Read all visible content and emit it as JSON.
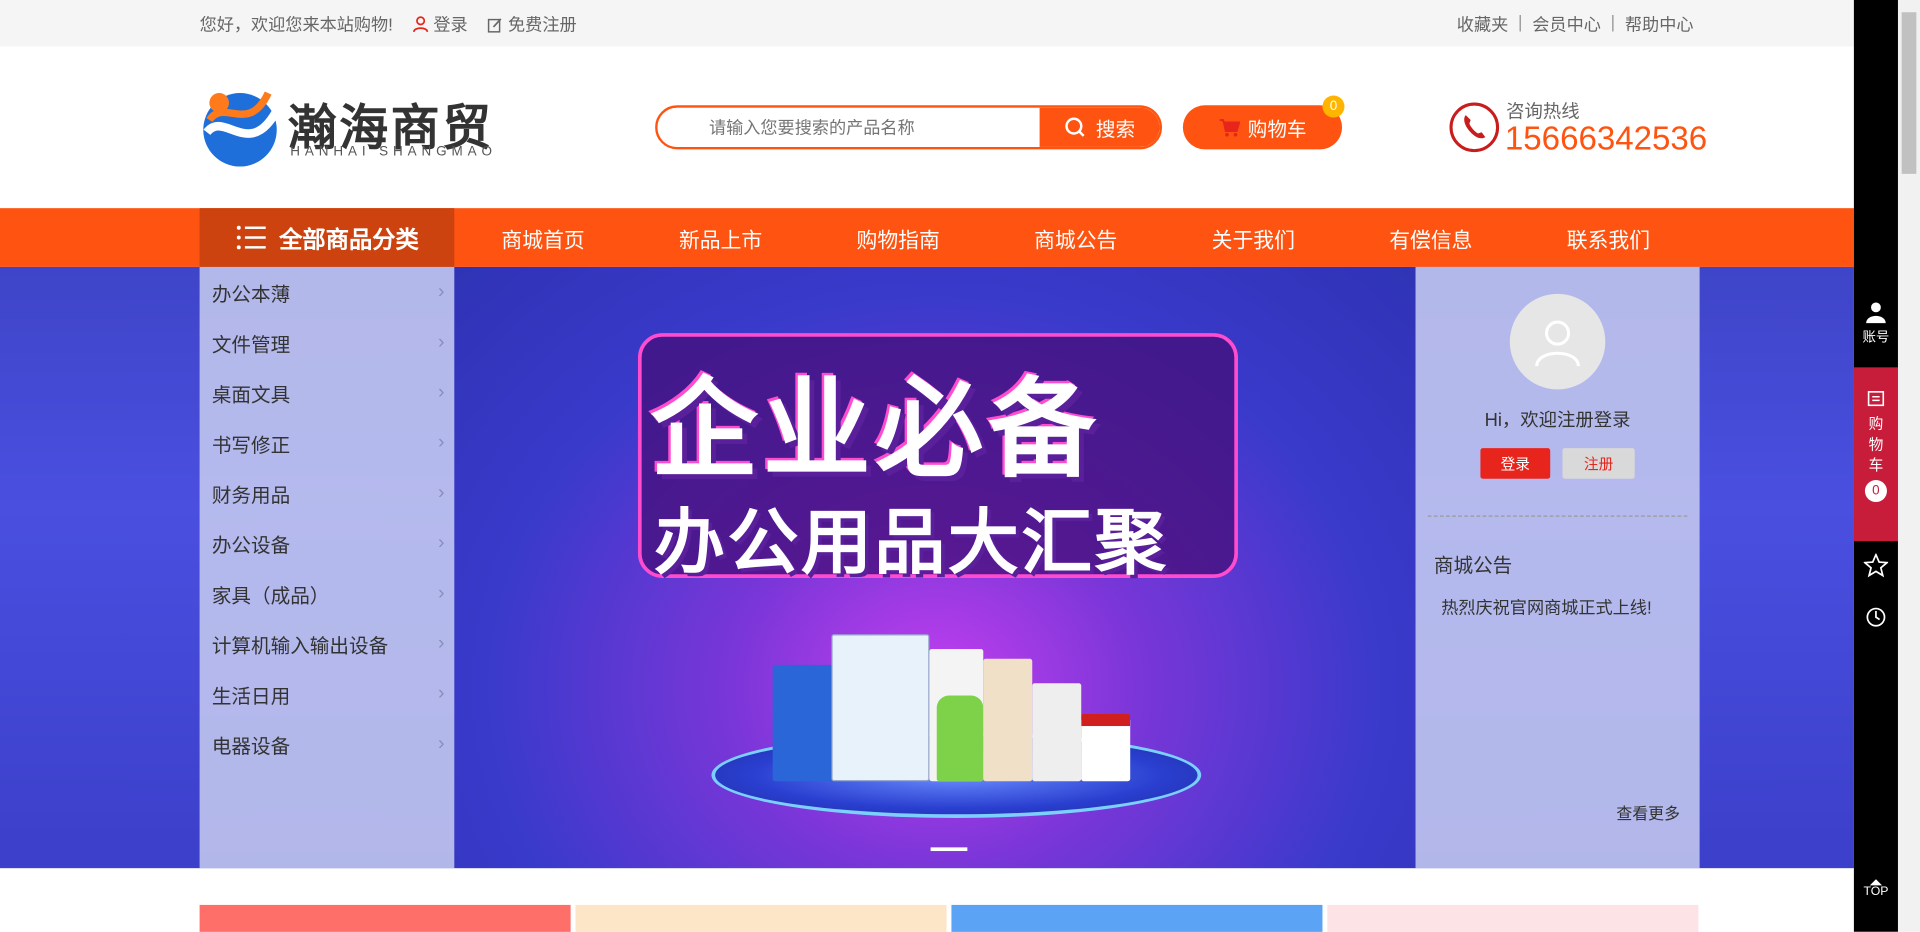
{
  "topbar": {
    "welcome": "您好，欢迎您来本站购物!",
    "login": "登录",
    "register": "免费注册",
    "favorites": "收藏夹",
    "member_center": "会员中心",
    "help_center": "帮助中心",
    "separator": "|"
  },
  "header": {
    "logo_text": "瀚海商贸",
    "logo_sub": "HANHAI SHANGMAO",
    "search_placeholder": "请输入您要搜索的产品名称",
    "search_button": "搜索",
    "cart_label": "购物车",
    "cart_count": "0",
    "hotline_label": "咨询热线",
    "hotline_number": "15666342536"
  },
  "nav": {
    "all_categories": "全部商品分类",
    "items": [
      "商城首页",
      "新品上市",
      "购物指南",
      "商城公告",
      "关于我们",
      "有偿信息",
      "联系我们"
    ]
  },
  "categories": [
    "办公本薄",
    "文件管理",
    "桌面文具",
    "书写修正",
    "财务用品",
    "办公设备",
    "家具（成品）",
    "计算机输入输出设备",
    "生活日用",
    "电器设备"
  ],
  "banner": {
    "title_line1": "企业必备",
    "title_line2": "办公用品大汇聚"
  },
  "user_panel": {
    "greeting": "Hi，欢迎注册登录",
    "login_button": "登录",
    "register_button": "注册",
    "notice_title": "商城公告",
    "notice_item": "热烈庆祝官网商城正式上线!",
    "more": "查看更多"
  },
  "sidebar": {
    "account": "账号",
    "cart": [
      "购",
      "物",
      "车"
    ],
    "cart_count": "0",
    "top": "TOP"
  },
  "colors": {
    "accent": "#ff5411",
    "accent_dark": "#cc4310",
    "banner_bg": "#4a4fe0",
    "sidebar_cart": "#c81d3a"
  }
}
